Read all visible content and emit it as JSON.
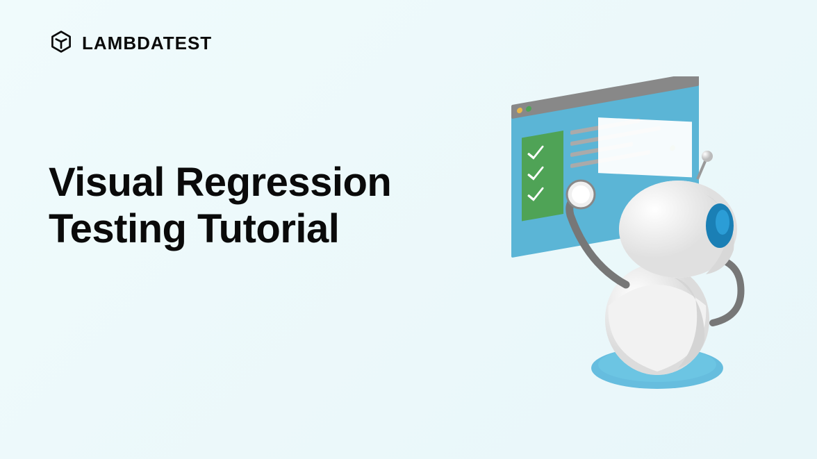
{
  "brand": {
    "name": "LAMBDATEST"
  },
  "headline": {
    "line1": "Visual Regression",
    "line2": "Testing Tutorial"
  }
}
